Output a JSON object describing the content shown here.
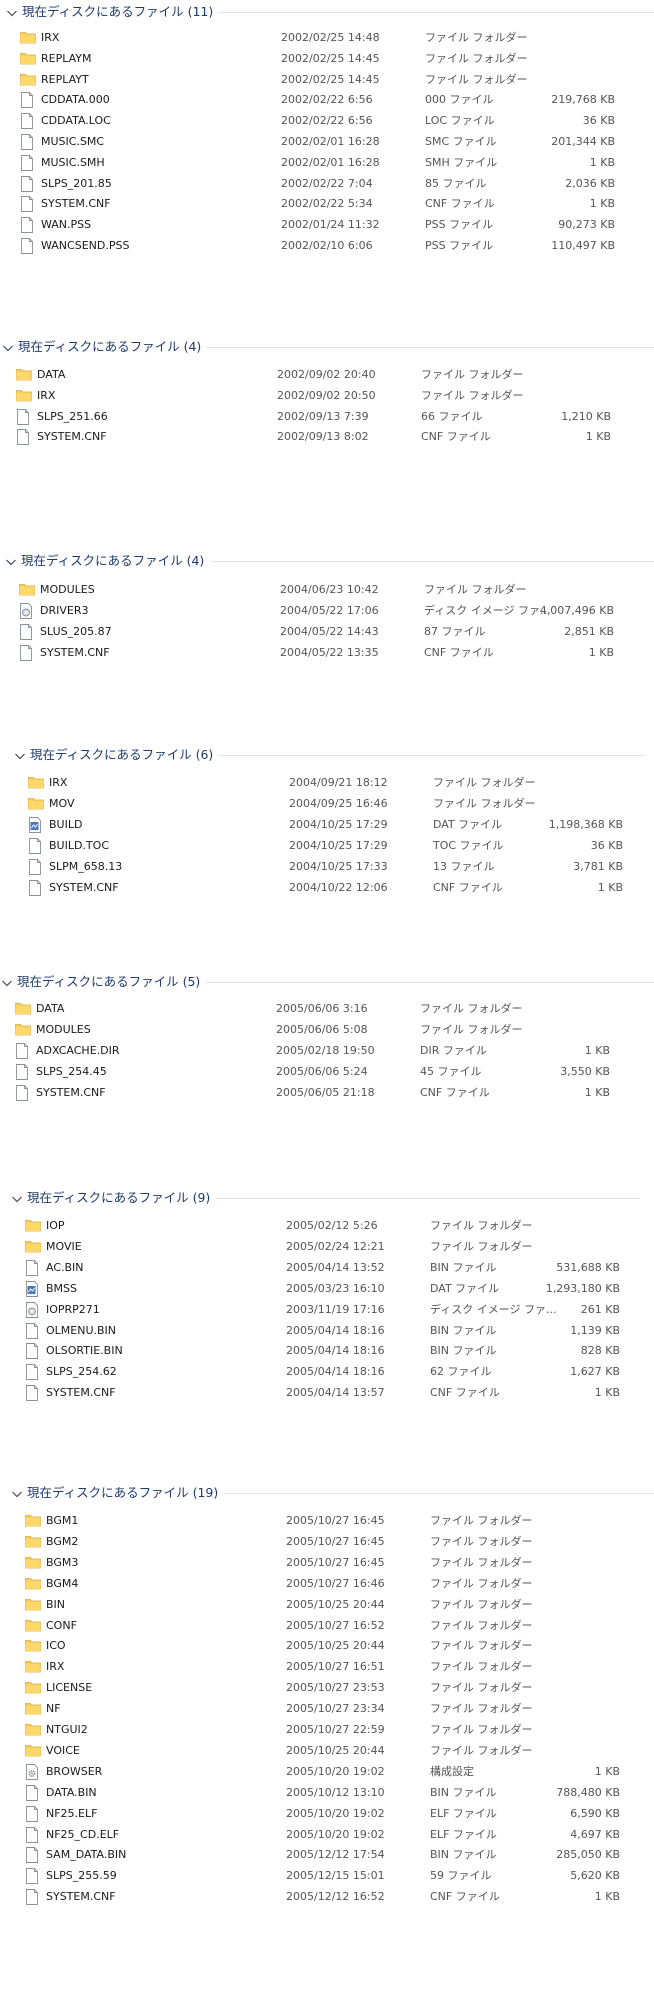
{
  "groups": [
    {
      "title": "現在ディスクにあるファイル (11)",
      "items": [
        {
          "name": "IRX",
          "date": "2002/02/25 14:48",
          "type": "ファイル フォルダー",
          "size": "",
          "icon": "folder-icon"
        },
        {
          "name": "REPLAYM",
          "date": "2002/02/25 14:45",
          "type": "ファイル フォルダー",
          "size": "",
          "icon": "folder-icon"
        },
        {
          "name": "REPLAYT",
          "date": "2002/02/25 14:45",
          "type": "ファイル フォルダー",
          "size": "",
          "icon": "folder-icon"
        },
        {
          "name": "CDDATA.000",
          "date": "2002/02/22 6:56",
          "type": "000 ファイル",
          "size": "219,768 KB",
          "icon": "file-icon"
        },
        {
          "name": "CDDATA.LOC",
          "date": "2002/02/22 6:56",
          "type": "LOC ファイル",
          "size": "36 KB",
          "icon": "file-icon"
        },
        {
          "name": "MUSIC.SMC",
          "date": "2002/02/01 16:28",
          "type": "SMC ファイル",
          "size": "201,344 KB",
          "icon": "file-icon"
        },
        {
          "name": "MUSIC.SMH",
          "date": "2002/02/01 16:28",
          "type": "SMH ファイル",
          "size": "1 KB",
          "icon": "file-icon"
        },
        {
          "name": "SLPS_201.85",
          "date": "2002/02/22 7:04",
          "type": "85 ファイル",
          "size": "2,036 KB",
          "icon": "file-icon"
        },
        {
          "name": "SYSTEM.CNF",
          "date": "2002/02/22 5:34",
          "type": "CNF ファイル",
          "size": "1 KB",
          "icon": "file-icon"
        },
        {
          "name": "WAN.PSS",
          "date": "2002/01/24 11:32",
          "type": "PSS ファイル",
          "size": "90,273 KB",
          "icon": "file-icon"
        },
        {
          "name": "WANCSEND.PSS",
          "date": "2002/02/10 6:06",
          "type": "PSS ファイル",
          "size": "110,497 KB",
          "icon": "file-icon"
        }
      ]
    },
    {
      "title": "現在ディスクにあるファイル (4)",
      "items": [
        {
          "name": "DATA",
          "date": "2002/09/02 20:40",
          "type": "ファイル フォルダー",
          "size": "",
          "icon": "folder-icon"
        },
        {
          "name": "IRX",
          "date": "2002/09/02 20:50",
          "type": "ファイル フォルダー",
          "size": "",
          "icon": "folder-icon"
        },
        {
          "name": "SLPS_251.66",
          "date": "2002/09/13 7:39",
          "type": "66 ファイル",
          "size": "1,210 KB",
          "icon": "file-icon"
        },
        {
          "name": "SYSTEM.CNF",
          "date": "2002/09/13 8:02",
          "type": "CNF ファイル",
          "size": "1 KB",
          "icon": "file-icon"
        }
      ]
    },
    {
      "title": "現在ディスクにあるファイル (4)",
      "items": [
        {
          "name": "MODULES",
          "date": "2004/06/23 10:42",
          "type": "ファイル フォルダー",
          "size": "",
          "icon": "folder-icon"
        },
        {
          "name": "DRIVER3",
          "date": "2004/05/22 17:06",
          "type": "ディスク イメージ ファ...",
          "size": "4,007,496 KB",
          "icon": "disc-image-icon"
        },
        {
          "name": "SLUS_205.87",
          "date": "2004/05/22 14:43",
          "type": "87 ファイル",
          "size": "2,851 KB",
          "icon": "file-icon"
        },
        {
          "name": "SYSTEM.CNF",
          "date": "2004/05/22 13:35",
          "type": "CNF ファイル",
          "size": "1 KB",
          "icon": "file-icon"
        }
      ]
    },
    {
      "title": "現在ディスクにあるファイル (6)",
      "items": [
        {
          "name": "IRX",
          "date": "2004/09/21 18:12",
          "type": "ファイル フォルダー",
          "size": "",
          "icon": "folder-icon"
        },
        {
          "name": "MOV",
          "date": "2004/09/25 16:46",
          "type": "ファイル フォルダー",
          "size": "",
          "icon": "folder-icon"
        },
        {
          "name": "BUILD",
          "date": "2004/10/25 17:29",
          "type": "DAT ファイル",
          "size": "1,198,368 KB",
          "icon": "dat-file-icon"
        },
        {
          "name": "BUILD.TOC",
          "date": "2004/10/25 17:29",
          "type": "TOC ファイル",
          "size": "36 KB",
          "icon": "file-icon"
        },
        {
          "name": "SLPM_658.13",
          "date": "2004/10/25 17:33",
          "type": "13 ファイル",
          "size": "3,781 KB",
          "icon": "file-icon"
        },
        {
          "name": "SYSTEM.CNF",
          "date": "2004/10/22 12:06",
          "type": "CNF ファイル",
          "size": "1 KB",
          "icon": "file-icon"
        }
      ]
    },
    {
      "title": "現在ディスクにあるファイル (5)",
      "items": [
        {
          "name": "DATA",
          "date": "2005/06/06 3:16",
          "type": "ファイル フォルダー",
          "size": "",
          "icon": "folder-icon"
        },
        {
          "name": "MODULES",
          "date": "2005/06/06 5:08",
          "type": "ファイル フォルダー",
          "size": "",
          "icon": "folder-icon"
        },
        {
          "name": "ADXCACHE.DIR",
          "date": "2005/02/18 19:50",
          "type": "DIR ファイル",
          "size": "1 KB",
          "icon": "file-icon"
        },
        {
          "name": "SLPS_254.45",
          "date": "2005/06/06 5:24",
          "type": "45 ファイル",
          "size": "3,550 KB",
          "icon": "file-icon"
        },
        {
          "name": "SYSTEM.CNF",
          "date": "2005/06/05 21:18",
          "type": "CNF ファイル",
          "size": "1 KB",
          "icon": "file-icon"
        }
      ]
    },
    {
      "title": "現在ディスクにあるファイル (9)",
      "items": [
        {
          "name": "IOP",
          "date": "2005/02/12 5:26",
          "type": "ファイル フォルダー",
          "size": "",
          "icon": "folder-icon"
        },
        {
          "name": "MOVIE",
          "date": "2005/02/24 12:21",
          "type": "ファイル フォルダー",
          "size": "",
          "icon": "folder-icon"
        },
        {
          "name": "AC.BIN",
          "date": "2005/04/14 13:52",
          "type": "BIN ファイル",
          "size": "531,688 KB",
          "icon": "file-icon"
        },
        {
          "name": "BMSS",
          "date": "2005/03/23 16:10",
          "type": "DAT ファイル",
          "size": "1,293,180 KB",
          "icon": "dat-file-icon"
        },
        {
          "name": "IOPRP271",
          "date": "2003/11/19 17:16",
          "type": "ディスク イメージ ファ...",
          "size": "261 KB",
          "icon": "disc-image-icon"
        },
        {
          "name": "OLMENU.BIN",
          "date": "2005/04/14 18:16",
          "type": "BIN ファイル",
          "size": "1,139 KB",
          "icon": "file-icon"
        },
        {
          "name": "OLSORTIE.BIN",
          "date": "2005/04/14 18:16",
          "type": "BIN ファイル",
          "size": "828 KB",
          "icon": "file-icon"
        },
        {
          "name": "SLPS_254.62",
          "date": "2005/04/14 18:16",
          "type": "62 ファイル",
          "size": "1,627 KB",
          "icon": "file-icon"
        },
        {
          "name": "SYSTEM.CNF",
          "date": "2005/04/14 13:57",
          "type": "CNF ファイル",
          "size": "1 KB",
          "icon": "file-icon"
        }
      ]
    },
    {
      "title": "現在ディスクにあるファイル (19)",
      "items": [
        {
          "name": "BGM1",
          "date": "2005/10/27 16:45",
          "type": "ファイル フォルダー",
          "size": "",
          "icon": "folder-icon"
        },
        {
          "name": "BGM2",
          "date": "2005/10/27 16:45",
          "type": "ファイル フォルダー",
          "size": "",
          "icon": "folder-icon"
        },
        {
          "name": "BGM3",
          "date": "2005/10/27 16:45",
          "type": "ファイル フォルダー",
          "size": "",
          "icon": "folder-icon"
        },
        {
          "name": "BGM4",
          "date": "2005/10/27 16:46",
          "type": "ファイル フォルダー",
          "size": "",
          "icon": "folder-icon"
        },
        {
          "name": "BIN",
          "date": "2005/10/25 20:44",
          "type": "ファイル フォルダー",
          "size": "",
          "icon": "folder-icon"
        },
        {
          "name": "CONF",
          "date": "2005/10/27 16:52",
          "type": "ファイル フォルダー",
          "size": "",
          "icon": "folder-icon"
        },
        {
          "name": "ICO",
          "date": "2005/10/25 20:44",
          "type": "ファイル フォルダー",
          "size": "",
          "icon": "folder-icon"
        },
        {
          "name": "IRX",
          "date": "2005/10/27 16:51",
          "type": "ファイル フォルダー",
          "size": "",
          "icon": "folder-icon"
        },
        {
          "name": "LICENSE",
          "date": "2005/10/27 23:53",
          "type": "ファイル フォルダー",
          "size": "",
          "icon": "folder-icon"
        },
        {
          "name": "NF",
          "date": "2005/10/27 23:34",
          "type": "ファイル フォルダー",
          "size": "",
          "icon": "folder-icon"
        },
        {
          "name": "NTGUI2",
          "date": "2005/10/27 22:59",
          "type": "ファイル フォルダー",
          "size": "",
          "icon": "folder-icon"
        },
        {
          "name": "VOICE",
          "date": "2005/10/25 20:44",
          "type": "ファイル フォルダー",
          "size": "",
          "icon": "folder-icon"
        },
        {
          "name": "BROWSER",
          "date": "2005/10/20 19:02",
          "type": "構成設定",
          "size": "1 KB",
          "icon": "settings-file-icon"
        },
        {
          "name": "DATA.BIN",
          "date": "2005/10/12 13:10",
          "type": "BIN ファイル",
          "size": "788,480 KB",
          "icon": "file-icon"
        },
        {
          "name": "NF25.ELF",
          "date": "2005/10/20 19:02",
          "type": "ELF ファイル",
          "size": "6,590 KB",
          "icon": "file-icon"
        },
        {
          "name": "NF25_CD.ELF",
          "date": "2005/10/20 19:02",
          "type": "ELF ファイル",
          "size": "4,697 KB",
          "icon": "file-icon"
        },
        {
          "name": "SAM_DATA.BIN",
          "date": "2005/12/12 17:54",
          "type": "BIN ファイル",
          "size": "285,050 KB",
          "icon": "file-icon"
        },
        {
          "name": "SLPS_255.59",
          "date": "2005/12/15 15:01",
          "type": "59 ファイル",
          "size": "5,620 KB",
          "icon": "file-icon"
        },
        {
          "name": "SYSTEM.CNF",
          "date": "2005/12/12 16:52",
          "type": "CNF ファイル",
          "size": "1 KB",
          "icon": "file-icon"
        }
      ]
    }
  ]
}
